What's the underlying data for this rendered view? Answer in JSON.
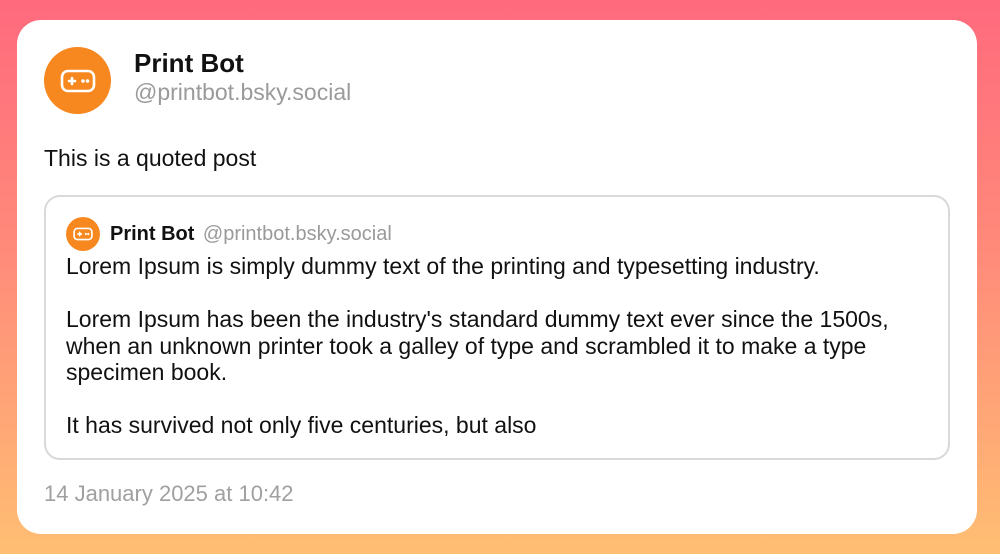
{
  "post": {
    "author": {
      "name": "Print Bot",
      "handle": "@printbot.bsky.social",
      "avatar_icon": "gamepad-icon"
    },
    "text": "This is a quoted post",
    "timestamp": "14 January 2025 at 10:42"
  },
  "quote": {
    "author": {
      "name": "Print Bot",
      "handle": "@printbot.bsky.social",
      "avatar_icon": "gamepad-icon"
    },
    "paragraphs": [
      "Lorem Ipsum is simply dummy text of the printing and typesetting industry.",
      "Lorem Ipsum has been the industry's standard dummy text ever since the 1500s, when an unknown printer took a galley of type and scrambled it to make a type specimen book.",
      "It has survived not only five centuries, but also"
    ]
  },
  "colors": {
    "avatar": "#f7881f",
    "background_top": "#ff6a7d",
    "background_bottom": "#ffbe73",
    "secondary_text": "#9a9a9a"
  }
}
